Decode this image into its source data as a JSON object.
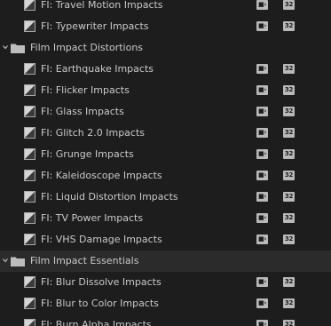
{
  "colors": {
    "panel_bg": "#1d1d1d",
    "selected_row_bg": "#2b2b2b",
    "text": "#c9c9c9",
    "badge_bg": "#b9b9b9"
  },
  "icons": {
    "folder": "folder-icon",
    "effect": "video-transition-icon",
    "accelerated": "accelerated-effect-icon",
    "bit_depth": "32-bit-color-icon"
  },
  "badges": {
    "bit_depth_label": "32"
  },
  "bins": [
    {
      "name": "",
      "items": [
        {
          "label": "FI: Travel Motion Impacts"
        },
        {
          "label": "FI: Typewriter Impacts"
        }
      ]
    },
    {
      "name": "Film Impact Distortions",
      "expanded": true,
      "items": [
        {
          "label": "FI: Earthquake Impacts"
        },
        {
          "label": "FI: Flicker Impacts"
        },
        {
          "label": "FI: Glass Impacts"
        },
        {
          "label": "FI: Glitch 2.0 Impacts"
        },
        {
          "label": "FI: Grunge Impacts"
        },
        {
          "label": "FI: Kaleidoscope Impacts"
        },
        {
          "label": "FI: Liquid Distortion Impacts"
        },
        {
          "label": "FI: TV Power Impacts"
        },
        {
          "label": "FI: VHS Damage Impacts"
        }
      ]
    },
    {
      "name": "Film Impact Essentials",
      "expanded": true,
      "selected": true,
      "items": [
        {
          "label": "FI: Blur Dissolve Impacts"
        },
        {
          "label": "FI: Blur to Color Impacts"
        },
        {
          "label": "FI: Burn Alpha Impacts"
        }
      ]
    }
  ]
}
